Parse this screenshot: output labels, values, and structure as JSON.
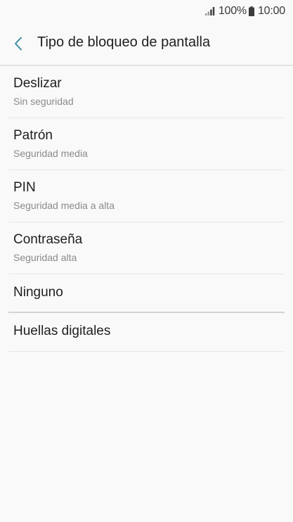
{
  "status_bar": {
    "battery": "100%",
    "time": "10:00",
    "icons": [
      "signal-icon",
      "battery-icon"
    ]
  },
  "header": {
    "back_icon": "chevron-left-icon",
    "title": "Tipo de bloqueo de pantalla",
    "accent_color": "#3d8ea0"
  },
  "options": [
    {
      "label": "Deslizar",
      "sub": "Sin seguridad"
    },
    {
      "label": "Patrón",
      "sub": "Seguridad media"
    },
    {
      "label": "PIN",
      "sub": "Seguridad media a alta"
    },
    {
      "label": "Contraseña",
      "sub": "Seguridad alta"
    },
    {
      "label": "Ninguno",
      "sub": ""
    },
    {
      "label": "Huellas digitales",
      "sub": ""
    }
  ]
}
